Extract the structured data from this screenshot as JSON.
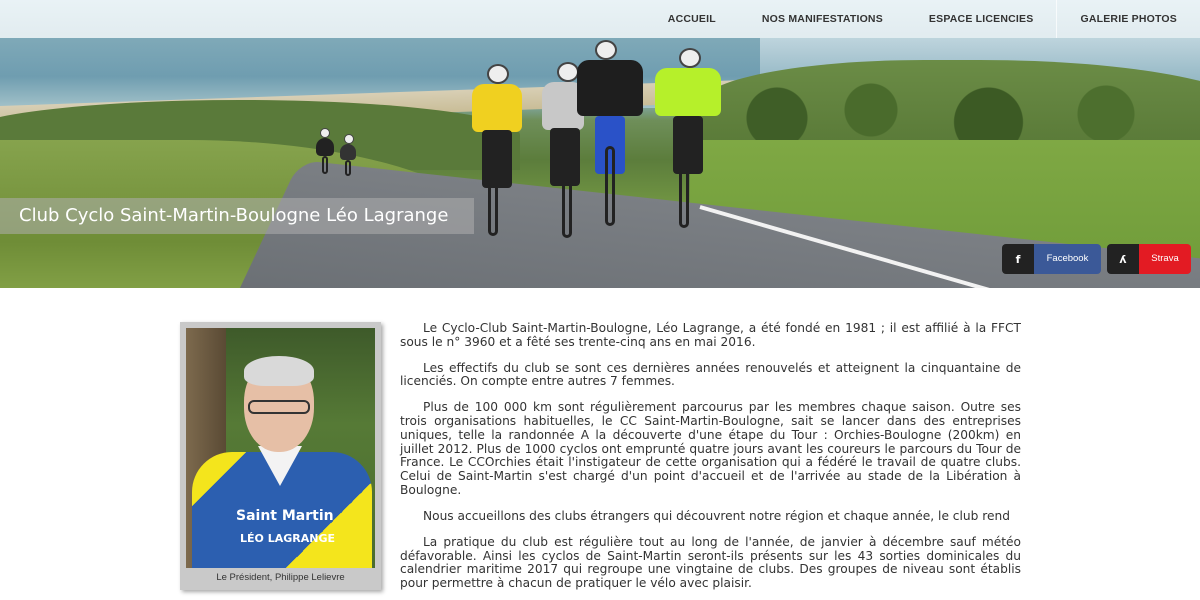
{
  "nav": {
    "items": [
      {
        "label": "ACCUEIL"
      },
      {
        "label": "NOS MANIFESTATIONS"
      },
      {
        "label": "ESPACE LICENCIES"
      },
      {
        "label": "GALERIE PHOTOS"
      }
    ]
  },
  "hero": {
    "title": "Club Cyclo Saint-Martin-Boulogne Léo Lagrange"
  },
  "social": {
    "facebook": {
      "icon": "facebook-icon",
      "glyph": "f",
      "label": "Facebook",
      "color": "#3b5998"
    },
    "strava": {
      "icon": "strava-icon",
      "glyph": "ʎ",
      "label": "Strava",
      "color": "#e31b23"
    }
  },
  "photo": {
    "jersey_line1": "Saint Martin",
    "jersey_line2": "LÉO LAGRANGE",
    "caption": "Le Président, Philippe Lelievre"
  },
  "article": {
    "paragraphs": [
      "Le Cyclo-Club Saint-Martin-Boulogne, Léo Lagrange, a été fondé en 1981 ; il est affilié à la FFCT sous le n° 3960 et a fêté ses trente-cinq ans en mai 2016.",
      "Les effectifs du club se sont ces dernières années renouvelés et atteignent la cinquantaine de licenciés. On compte entre autres 7 femmes.",
      "Plus de 100 000 km sont régulièrement parcourus par les membres chaque saison. Outre ses trois organisations habituelles, le CC Saint-Martin-Boulogne, sait se lancer dans des entreprises uniques, telle la randonnée A la découverte d'une étape du Tour : Orchies-Boulogne (200km) en juillet 2012. Plus de 1000 cyclos ont emprunté quatre jours avant les coureurs le parcours du Tour de France. Le CCOrchies était l'instigateur de cette organisation qui a fédéré le travail de quatre clubs. Celui de Saint-Martin s'est chargé d'un point d'accueil et de l'arrivée au stade de la Libération à Boulogne.",
      "Nous accueillons des clubs étrangers qui découvrent notre région et chaque année, le club rend",
      "La pratique du club est régulière tout au long de l'année, de janvier à décembre sauf météo défavorable. Ainsi les cyclos de Saint-Martin seront-ils présents sur les 43 sorties dominicales du calendrier maritime 2017 qui regroupe une vingtaine de clubs. Des groupes de niveau sont établis pour permettre à chacun de pratiquer le vélo avec plaisir."
    ]
  }
}
